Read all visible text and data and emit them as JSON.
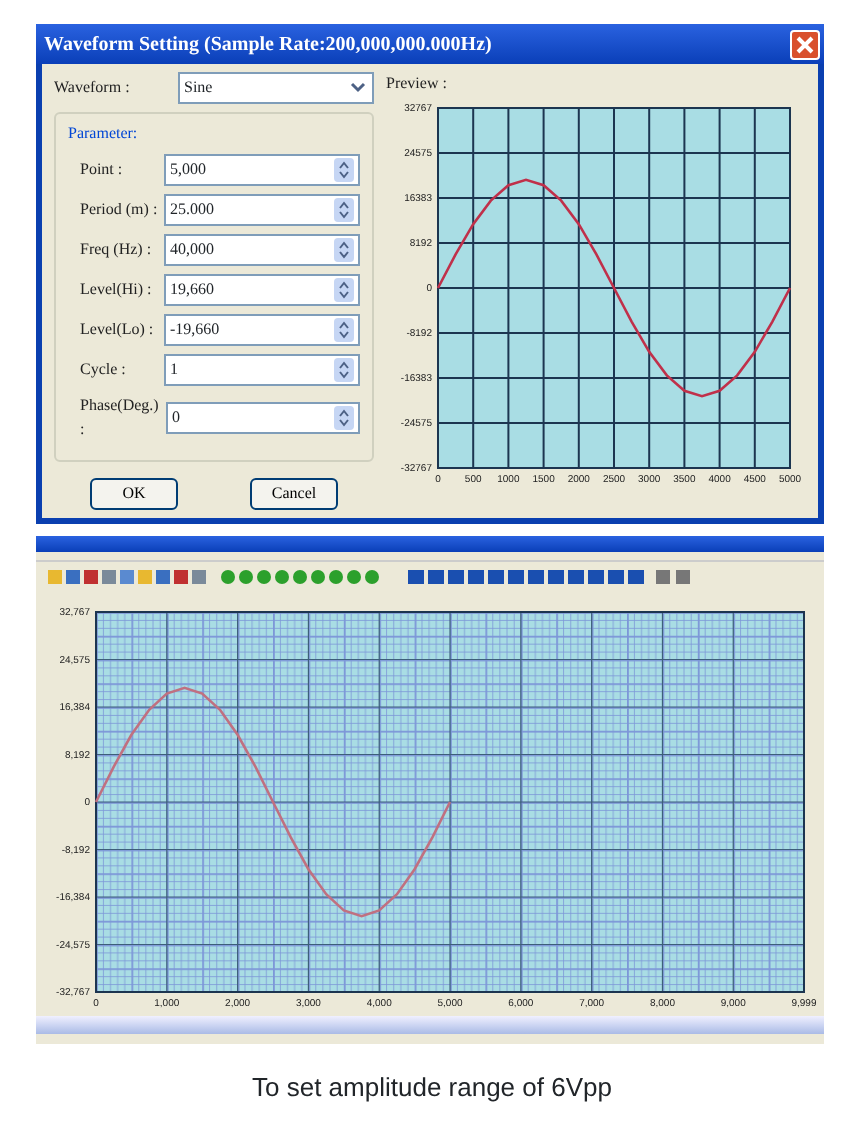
{
  "dialog": {
    "title": "Waveform Setting (Sample Rate:200,000,000.000Hz)",
    "waveform": {
      "label": "Waveform :",
      "value": "Sine"
    },
    "parameter_group": {
      "title": "Parameter:",
      "fields": [
        {
          "label": "Point :",
          "value": "5,000"
        },
        {
          "label": "Period (m) :",
          "value": "25.000"
        },
        {
          "label": "Freq (Hz) :",
          "value": "40,000"
        },
        {
          "label": "Level(Hi) :",
          "value": "19,660"
        },
        {
          "label": "Level(Lo) :",
          "value": "-19,660"
        },
        {
          "label": "Cycle :",
          "value": "1"
        },
        {
          "label": "Phase(Deg.) :",
          "value": "0"
        }
      ]
    },
    "buttons": [
      "OK",
      "Cancel"
    ],
    "preview": {
      "label": "Preview :",
      "chart_data": {
        "type": "line",
        "x": [
          0,
          250,
          500,
          750,
          1000,
          1250,
          1500,
          1750,
          2000,
          2250,
          2500,
          2750,
          3000,
          3250,
          3500,
          3750,
          4000,
          4250,
          4500,
          4750,
          5000
        ],
        "series": [
          {
            "color": "#c0304a",
            "values": [
              0,
              6100,
              11600,
              15900,
              18700,
              19700,
              18700,
              15900,
              11600,
              6100,
              0,
              -6100,
              -11600,
              -15900,
              -18700,
              -19700,
              -18700,
              -15900,
              -11600,
              -6100,
              0
            ]
          }
        ],
        "grid": true,
        "xlim": [
          0,
          5000
        ],
        "ylim": [
          -32767,
          32767
        ],
        "xticks": [
          0,
          500,
          1000,
          1500,
          2000,
          2500,
          3000,
          3500,
          4000,
          4500,
          5000
        ],
        "yticks": [
          {
            "value": 32767,
            "label": "32767"
          },
          {
            "value": 24575,
            "label": "24575"
          },
          {
            "value": 16383,
            "label": "16383"
          },
          {
            "value": 8192,
            "label": "8192"
          },
          {
            "value": 0,
            "label": "0"
          },
          {
            "value": -8192,
            "label": "-8192"
          },
          {
            "value": -16383,
            "label": "-16383"
          },
          {
            "value": -24575,
            "label": "-24575"
          },
          {
            "value": -32767,
            "label": "-32767"
          }
        ]
      }
    }
  },
  "main_window": {
    "chart_data": {
      "type": "line",
      "x": [
        0,
        250,
        500,
        750,
        1000,
        1250,
        1500,
        1750,
        2000,
        2250,
        2500,
        2750,
        3000,
        3250,
        3500,
        3750,
        4000,
        4250,
        4500,
        4750,
        5000
      ],
      "series": [
        {
          "color": "#c07080",
          "values": [
            0,
            6100,
            11600,
            15900,
            18700,
            19700,
            18700,
            15900,
            11600,
            6100,
            0,
            -6100,
            -11600,
            -15900,
            -18700,
            -19700,
            -18700,
            -15900,
            -11600,
            -6100,
            0
          ]
        }
      ],
      "grid": true,
      "xlim": [
        0,
        9999
      ],
      "ylim": [
        -32767,
        32767
      ],
      "xticks": [
        {
          "value": 0,
          "label": "0"
        },
        {
          "value": 1000,
          "label": "1,000"
        },
        {
          "value": 2000,
          "label": "2,000"
        },
        {
          "value": 3000,
          "label": "3,000"
        },
        {
          "value": 4000,
          "label": "4,000"
        },
        {
          "value": 5000,
          "label": "5,000"
        },
        {
          "value": 6000,
          "label": "6,000"
        },
        {
          "value": 7000,
          "label": "7,000"
        },
        {
          "value": 8000,
          "label": "8,000"
        },
        {
          "value": 9000,
          "label": "9,000"
        },
        {
          "value": 9999,
          "label": "9,999"
        }
      ],
      "yticks": [
        {
          "value": 32767,
          "label": "32,767"
        },
        {
          "value": 24575,
          "label": "24,575"
        },
        {
          "value": 16384,
          "label": "16,384"
        },
        {
          "value": 8192,
          "label": "8,192"
        },
        {
          "value": 0,
          "label": "0"
        },
        {
          "value": -8192,
          "label": "-8,192"
        },
        {
          "value": -16384,
          "label": "-16,384"
        },
        {
          "value": -24575,
          "label": "-24,575"
        },
        {
          "value": -32767,
          "label": "-32,767"
        }
      ]
    }
  },
  "caption": "To set amplitude range of 6Vpp"
}
